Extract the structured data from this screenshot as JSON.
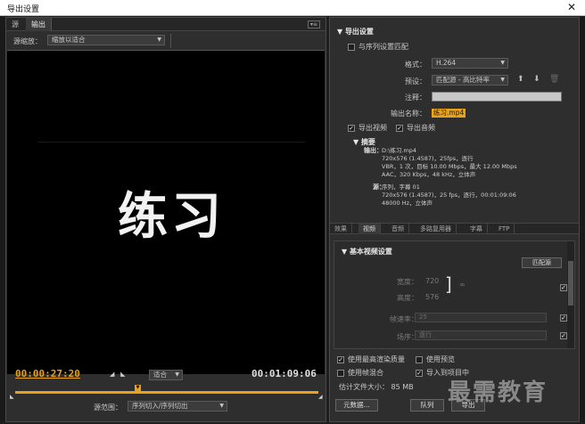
{
  "window": {
    "title": "导出设置",
    "close_glyph": "✕"
  },
  "left": {
    "tabs": [
      "源",
      "输出"
    ],
    "source_scaling": {
      "label": "源缩放：",
      "value": "缩放以适合"
    },
    "video_text": "练习",
    "current_timecode": "00:00:27:20",
    "duration_timecode": "00:01:09:06",
    "fit": "适合",
    "range": {
      "label": "源范围：",
      "value": "序列切入/序列切出"
    }
  },
  "right": {
    "export_settings": {
      "heading": "导出设置",
      "match_sequence": "与序列设置匹配",
      "format_label": "格式：",
      "format_value": "H.264",
      "preset_label": "预设：",
      "preset_value": "匹配源 - 高比特率",
      "comments_label": "注释：",
      "comments_value": "",
      "output_name_label": "输出名称：",
      "output_name_value": "练习.mp4",
      "export_video": "导出视频",
      "export_audio": "导出音频"
    },
    "summary": {
      "heading": "摘要",
      "output_label": "输出：",
      "output_lines": [
        "D:\\练习.mp4",
        "720x576 (1.4587)，25fps，逐行",
        "VBR，1 次，目标 10.00 Mbps，最大 12.00 Mbps",
        "AAC，320 Kbps，48  kHz，立体声"
      ],
      "source_label": "源：",
      "source_lines": [
        "序列，字幕 01",
        "720x576 (1.4587)，25 fps，逐行，00:01:09:06",
        "48000 Hz，立体声"
      ]
    },
    "subtabs": [
      "效果",
      "视频",
      "音频",
      "多路复用器",
      "字幕",
      "FTP"
    ],
    "video_panel": {
      "heading": "基本视频设置",
      "match_source": "匹配源",
      "width_label": "宽度：",
      "width_value": "720",
      "height_label": "高度：",
      "height_value": "576",
      "framerate_label": "帧速率：",
      "framerate_value": "25",
      "field_order_label": "场序：",
      "field_order_value": "逐行"
    },
    "options": {
      "max_render_quality": "使用最高渲染质量",
      "use_previews": "使用预览",
      "frame_blending": "使用帧混合",
      "import_into_project": "导入到项目中",
      "file_size": "估计文件大小：  85 MB"
    },
    "buttons": {
      "metadata": "元数据...",
      "queue": "队列",
      "export": "导出"
    },
    "watermark": "最需教育"
  },
  "colors": {
    "accent": "#e8a21c",
    "panel": "#2e2e2e",
    "bg": "#1e1e1e"
  }
}
